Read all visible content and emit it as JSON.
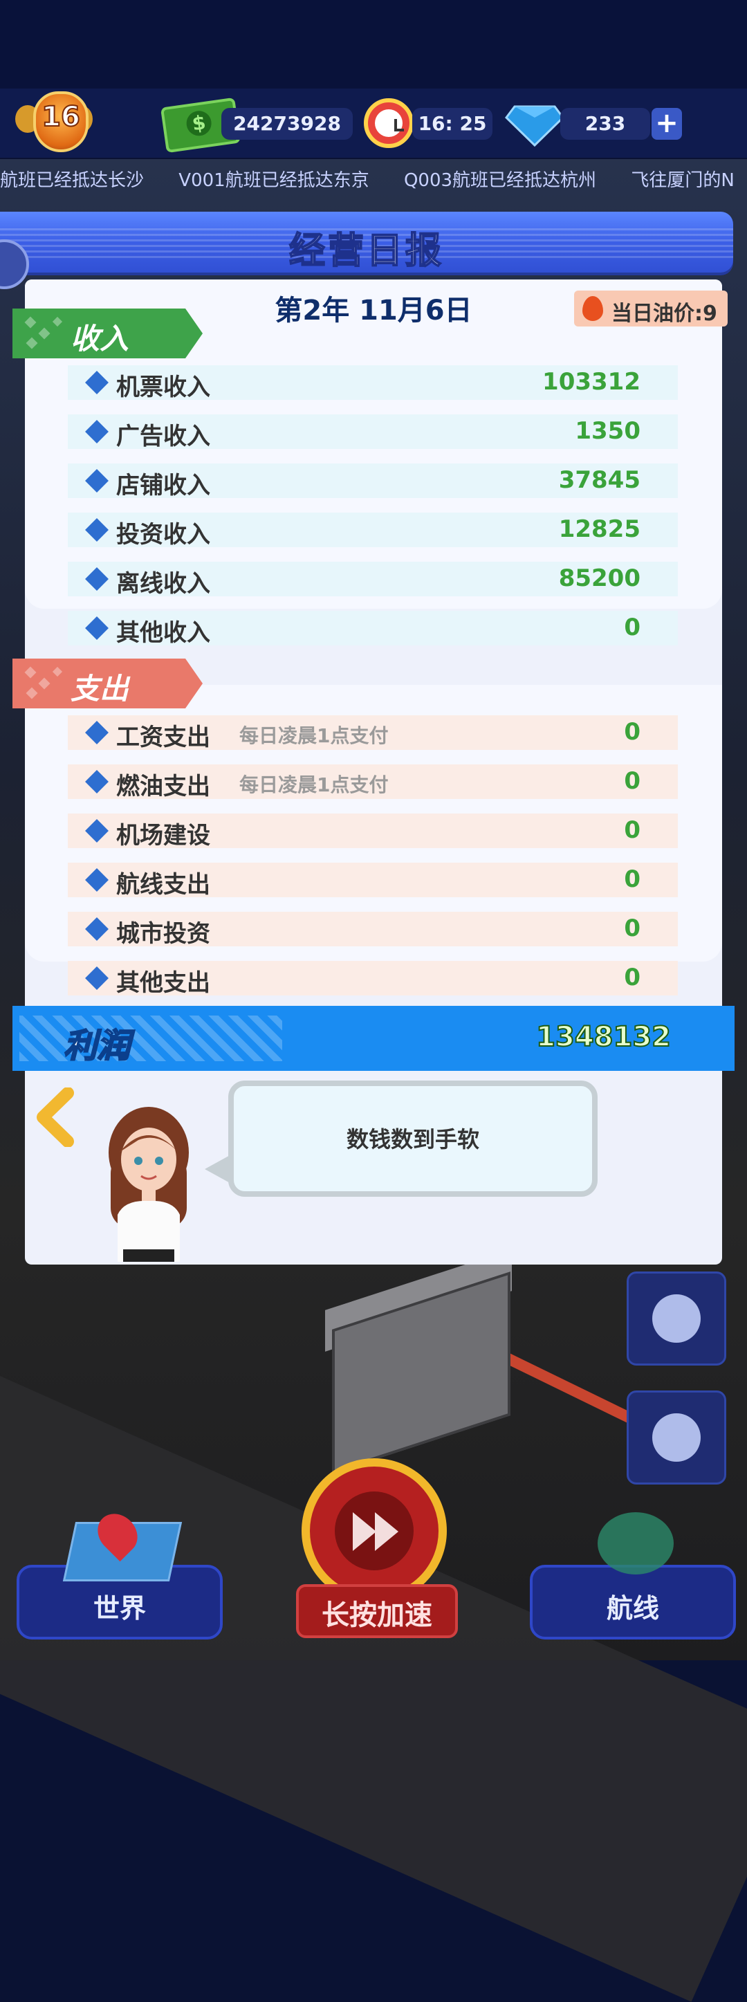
{
  "hud": {
    "level": "16",
    "money": "24273928",
    "time": "16: 25",
    "gems": "233",
    "plus_label": "+"
  },
  "ticker": [
    "航班已经抵达长沙",
    "V001航班已经抵达东京",
    "Q003航班已经抵达杭州",
    "飞往厦门的N"
  ],
  "report": {
    "title": "经营日报",
    "date": "第2年 11月6日",
    "oil_price": "当日油价:9",
    "income_label": "收入",
    "income": [
      {
        "label": "机票收入",
        "value": "103312"
      },
      {
        "label": "广告收入",
        "value": "1350"
      },
      {
        "label": "店铺收入",
        "value": "37845"
      },
      {
        "label": "投资收入",
        "value": "12825"
      },
      {
        "label": "离线收入",
        "value": "85200"
      },
      {
        "label": "其他收入",
        "value": "0"
      }
    ],
    "expense_label": "支出",
    "expense": [
      {
        "label": "工资支出",
        "note": "每日凌晨1点支付",
        "value": "0"
      },
      {
        "label": "燃油支出",
        "note": "每日凌晨1点支付",
        "value": "0"
      },
      {
        "label": "机场建设",
        "note": "",
        "value": "0"
      },
      {
        "label": "航线支出",
        "note": "",
        "value": "0"
      },
      {
        "label": "城市投资",
        "note": "",
        "value": "0"
      },
      {
        "label": "其他支出",
        "note": "",
        "value": "0"
      }
    ],
    "profit_label": "利润",
    "profit_value": "1348132",
    "speech": "数钱数到手软"
  },
  "bottom": {
    "world": "世界",
    "speed": "长按加速",
    "routes": "航线"
  },
  "colors": {
    "income_tab": "#3ea34a",
    "expense_tab": "#e9796a",
    "profit_bar": "#1a8cf2",
    "value_green": "#3aa33a"
  }
}
